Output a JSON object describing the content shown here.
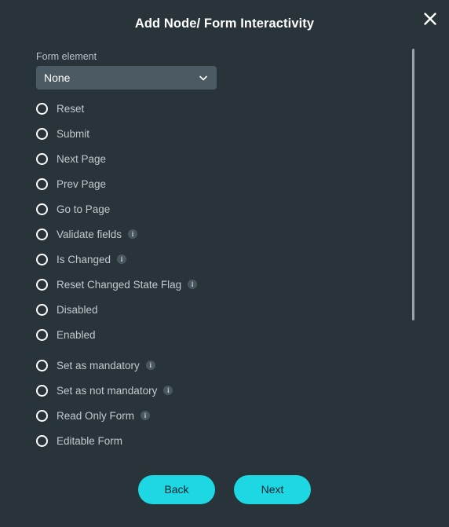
{
  "dialog": {
    "title": "Add Node/ Form Interactivity",
    "close_icon": "close-icon"
  },
  "form": {
    "element_label": "Form element",
    "select": {
      "value": "None",
      "chevron_icon": "chevron-down-icon"
    }
  },
  "options": [
    {
      "label": "Reset",
      "info": false,
      "group_start": false
    },
    {
      "label": "Submit",
      "info": false,
      "group_start": false
    },
    {
      "label": "Next Page",
      "info": false,
      "group_start": false
    },
    {
      "label": "Prev Page",
      "info": false,
      "group_start": false
    },
    {
      "label": "Go to Page",
      "info": false,
      "group_start": false
    },
    {
      "label": "Validate fields",
      "info": true,
      "group_start": false
    },
    {
      "label": "Is Changed",
      "info": true,
      "group_start": false
    },
    {
      "label": "Reset Changed State Flag",
      "info": true,
      "group_start": false
    },
    {
      "label": "Disabled",
      "info": false,
      "group_start": false
    },
    {
      "label": "Enabled",
      "info": false,
      "group_start": false
    },
    {
      "label": "Set as mandatory",
      "info": true,
      "group_start": true
    },
    {
      "label": "Set as not mandatory",
      "info": true,
      "group_start": false
    },
    {
      "label": "Read Only Form",
      "info": true,
      "group_start": false
    },
    {
      "label": "Editable Form",
      "info": false,
      "group_start": false
    }
  ],
  "info_glyph": "i",
  "footer": {
    "back_label": "Back",
    "next_label": "Next"
  },
  "colors": {
    "background": "#28333a",
    "accent": "#1dd8e2",
    "select_background": "#4c5a64",
    "label_text": "#c2cace",
    "scrollbar": "#9aa3a9"
  }
}
